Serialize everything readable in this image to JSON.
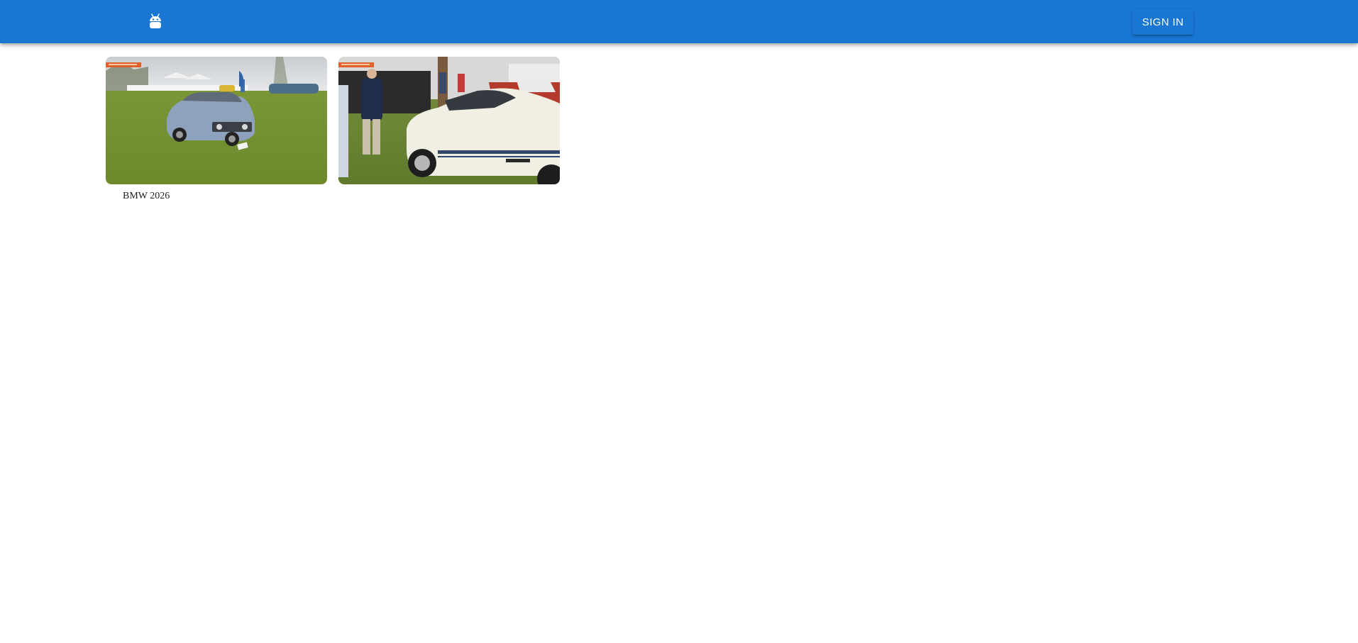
{
  "header": {
    "logo_icon": "android-robot-icon",
    "sign_in_label": "SIGN IN",
    "background_color": "#1976d2"
  },
  "gallery": {
    "cards": [
      {
        "image": "blue-bmw-coupe-on-lawn-photo",
        "caption": "BMW 2026"
      },
      {
        "image": "white-mustang-fastback-on-lawn-photo",
        "caption": ""
      }
    ]
  }
}
